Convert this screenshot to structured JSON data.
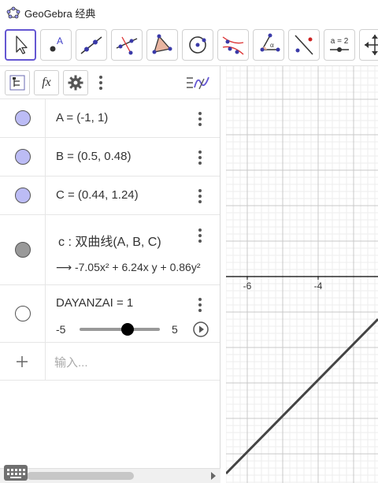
{
  "window": {
    "title": "GeoGebra 经典"
  },
  "toolbar": {
    "tools": [
      {
        "name": "move-tool"
      },
      {
        "name": "point-tool",
        "label": "A"
      },
      {
        "name": "line-tool"
      },
      {
        "name": "perpendicular-line-tool"
      },
      {
        "name": "polygon-tool"
      },
      {
        "name": "circle-tool"
      },
      {
        "name": "conic-tool"
      },
      {
        "name": "angle-tool",
        "label": "α"
      },
      {
        "name": "reflect-tool"
      },
      {
        "name": "slider-tool",
        "label": "a = 2"
      },
      {
        "name": "move-graphics-tool"
      }
    ]
  },
  "algebra": {
    "header": {
      "fx_label": "fx"
    },
    "rows": [
      {
        "text": "A = (-1, 1)",
        "color": "#bcbcf5"
      },
      {
        "text": "B = (0.5, 0.48)",
        "color": "#bcbcf5"
      },
      {
        "text": "C = (0.44, 1.24)",
        "color": "#bcbcf5"
      },
      {
        "definition": "c : 双曲线(A, B, C)",
        "value": "⟶  -7.05x² + 6.24x y + 0.86y²",
        "color": "#999999"
      },
      {
        "text": "DAYANZAI = 1",
        "slider_min": "-5",
        "slider_max": "5",
        "slider_value": 1,
        "color": "#ffffff"
      }
    ],
    "input_placeholder": "输入..."
  },
  "graphics": {
    "x_tick_labels": [
      "-6",
      "-4"
    ],
    "line_color": "#444444",
    "axis_color": "#000000"
  }
}
